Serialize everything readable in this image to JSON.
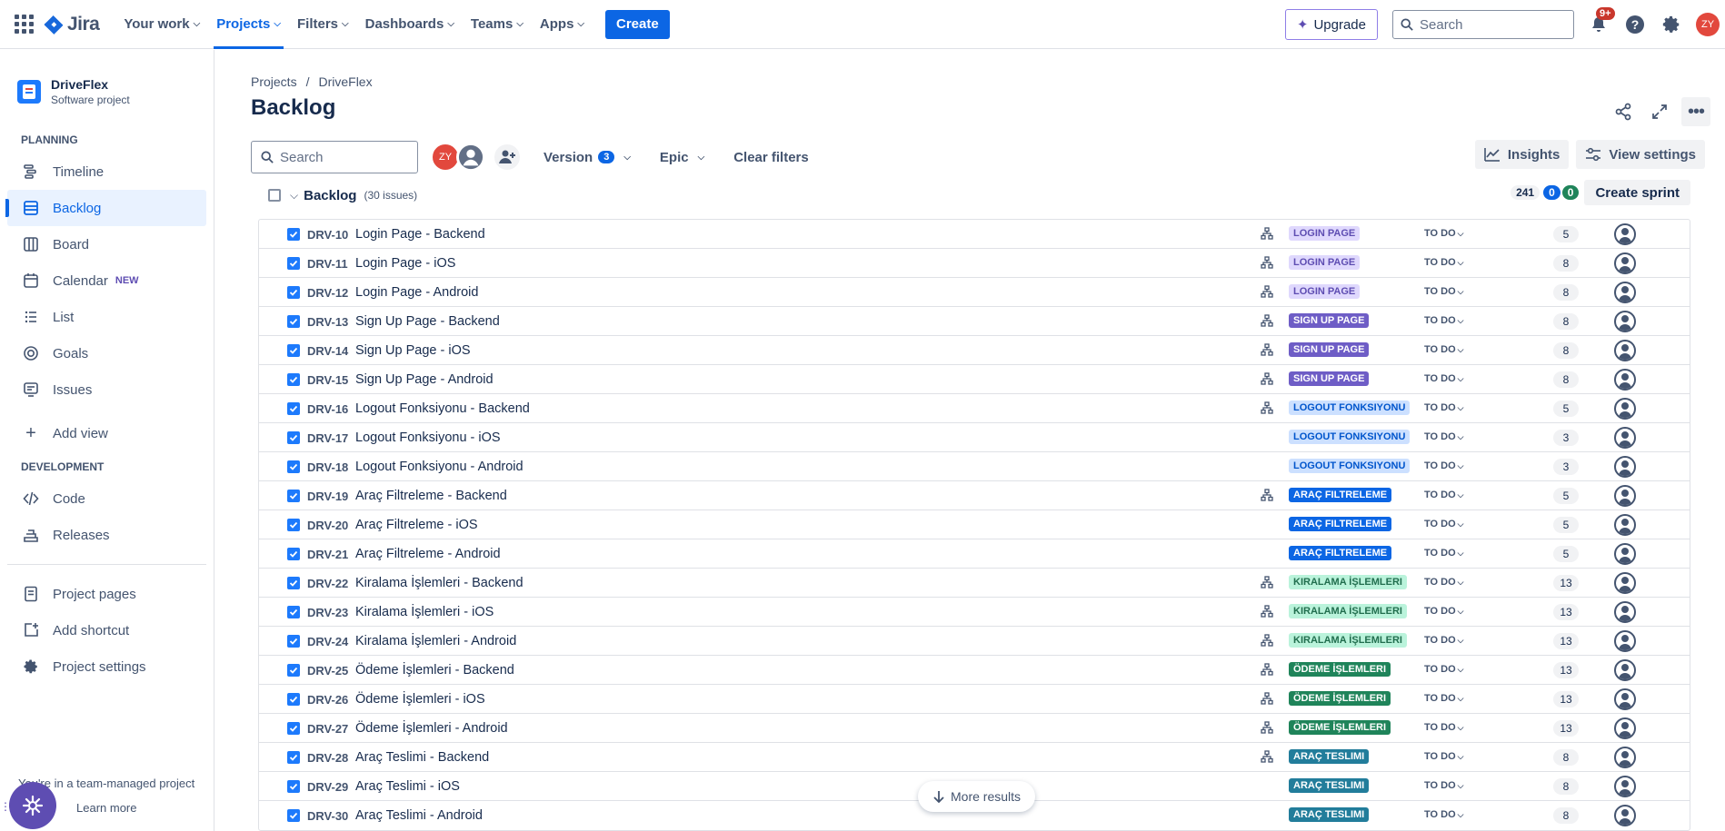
{
  "topbar": {
    "logo": "Jira",
    "nav": [
      {
        "label": "Your work",
        "active": false
      },
      {
        "label": "Projects",
        "active": true
      },
      {
        "label": "Filters",
        "active": false
      },
      {
        "label": "Dashboards",
        "active": false
      },
      {
        "label": "Teams",
        "active": false
      },
      {
        "label": "Apps",
        "active": false
      }
    ],
    "create_label": "Create",
    "upgrade_label": "Upgrade",
    "search_placeholder": "Search",
    "notifications_badge": "9+",
    "user_initials": "ZY"
  },
  "sidebar": {
    "project_name": "DriveFlex",
    "project_type": "Software project",
    "planning_title": "PLANNING",
    "planning_items": [
      {
        "label": "Timeline",
        "icon": "timeline-icon"
      },
      {
        "label": "Backlog",
        "icon": "backlog-icon",
        "active": true
      },
      {
        "label": "Board",
        "icon": "board-icon"
      },
      {
        "label": "Calendar",
        "icon": "calendar-icon",
        "tag": "NEW"
      },
      {
        "label": "List",
        "icon": "list-icon"
      },
      {
        "label": "Goals",
        "icon": "goals-icon"
      },
      {
        "label": "Issues",
        "icon": "issues-icon"
      }
    ],
    "add_view_label": "Add view",
    "development_title": "DEVELOPMENT",
    "development_items": [
      {
        "label": "Code",
        "icon": "code-icon"
      },
      {
        "label": "Releases",
        "icon": "releases-icon"
      }
    ],
    "project_pages_label": "Project pages",
    "add_shortcut_label": "Add shortcut",
    "project_settings_label": "Project settings",
    "footer_text": "You're in a team-managed project",
    "learn_more_label": "Learn more"
  },
  "main": {
    "breadcrumb": [
      "Projects",
      "DriveFlex"
    ],
    "title": "Backlog",
    "search_placeholder": "Search",
    "filter_avatar_initials": "ZY",
    "version_label": "Version",
    "version_count": "3",
    "epic_label": "Epic",
    "clear_filters_label": "Clear filters",
    "insights_label": "Insights",
    "view_settings_label": "View settings",
    "backlog_title": "Backlog",
    "backlog_count": "(30 issues)",
    "points_total": "241",
    "points_in_progress": "0",
    "points_done": "0",
    "create_sprint_label": "Create sprint",
    "more_results_label": "More results"
  },
  "colors": {
    "accent": "#0c66e4",
    "epic_login_bg": "#dfd8fd",
    "epic_login_fg": "#5e4db2",
    "epic_signup_bg": "#6e5dc6",
    "epic_signup_fg": "#ffffff",
    "epic_logout_bg": "#cce0ff",
    "epic_logout_fg": "#0055cc",
    "epic_filter_bg": "#0c66e4",
    "epic_filter_fg": "#ffffff",
    "epic_rental_bg": "#baf3db",
    "epic_rental_fg": "#216e4e",
    "epic_payment_bg": "#1f845a",
    "epic_payment_fg": "#ffffff",
    "epic_delivery_bg": "#227d9b",
    "epic_delivery_fg": "#ffffff"
  },
  "issues": [
    {
      "key": "DRV-10",
      "summary": "Login Page - Backend",
      "child": true,
      "epic": "LOGIN PAGE",
      "epic_style": "login",
      "status": "TO DO",
      "estimate": "5"
    },
    {
      "key": "DRV-11",
      "summary": "Login Page - iOS",
      "child": true,
      "epic": "LOGIN PAGE",
      "epic_style": "login",
      "status": "TO DO",
      "estimate": "8"
    },
    {
      "key": "DRV-12",
      "summary": "Login Page - Android",
      "child": true,
      "epic": "LOGIN PAGE",
      "epic_style": "login",
      "status": "TO DO",
      "estimate": "8"
    },
    {
      "key": "DRV-13",
      "summary": "Sign Up Page - Backend",
      "child": true,
      "epic": "SIGN UP PAGE",
      "epic_style": "signup",
      "status": "TO DO",
      "estimate": "8"
    },
    {
      "key": "DRV-14",
      "summary": "Sign Up Page - iOS",
      "child": true,
      "epic": "SIGN UP PAGE",
      "epic_style": "signup",
      "status": "TO DO",
      "estimate": "8"
    },
    {
      "key": "DRV-15",
      "summary": "Sign Up Page - Android",
      "child": true,
      "epic": "SIGN UP PAGE",
      "epic_style": "signup",
      "status": "TO DO",
      "estimate": "8"
    },
    {
      "key": "DRV-16",
      "summary": "Logout Fonksiyonu - Backend",
      "child": true,
      "epic": "LOGOUT FONKSIYONU",
      "epic_style": "logout",
      "status": "TO DO",
      "estimate": "5"
    },
    {
      "key": "DRV-17",
      "summary": "Logout Fonksiyonu - iOS",
      "child": false,
      "epic": "LOGOUT FONKSIYONU",
      "epic_style": "logout",
      "status": "TO DO",
      "estimate": "3"
    },
    {
      "key": "DRV-18",
      "summary": "Logout Fonksiyonu - Android",
      "child": false,
      "epic": "LOGOUT FONKSIYONU",
      "epic_style": "logout",
      "status": "TO DO",
      "estimate": "3"
    },
    {
      "key": "DRV-19",
      "summary": "Araç Filtreleme - Backend",
      "child": true,
      "epic": "ARAÇ FILTRELEME",
      "epic_style": "filter",
      "status": "TO DO",
      "estimate": "5"
    },
    {
      "key": "DRV-20",
      "summary": "Araç Filtreleme - iOS",
      "child": false,
      "epic": "ARAÇ FILTRELEME",
      "epic_style": "filter",
      "status": "TO DO",
      "estimate": "5"
    },
    {
      "key": "DRV-21",
      "summary": "Araç Filtreleme - Android",
      "child": false,
      "epic": "ARAÇ FILTRELEME",
      "epic_style": "filter",
      "status": "TO DO",
      "estimate": "5"
    },
    {
      "key": "DRV-22",
      "summary": "Kiralama İşlemleri - Backend",
      "child": true,
      "epic": "KIRALAMA İŞLEMLERI",
      "epic_style": "rental",
      "status": "TO DO",
      "estimate": "13"
    },
    {
      "key": "DRV-23",
      "summary": "Kiralama İşlemleri - iOS",
      "child": true,
      "epic": "KIRALAMA İŞLEMLERI",
      "epic_style": "rental",
      "status": "TO DO",
      "estimate": "13"
    },
    {
      "key": "DRV-24",
      "summary": "Kiralama İşlemleri - Android",
      "child": true,
      "epic": "KIRALAMA İŞLEMLERI",
      "epic_style": "rental",
      "status": "TO DO",
      "estimate": "13"
    },
    {
      "key": "DRV-25",
      "summary": "Ödeme İşlemleri - Backend",
      "child": true,
      "epic": "ÖDEME İŞLEMLERI",
      "epic_style": "payment",
      "status": "TO DO",
      "estimate": "13"
    },
    {
      "key": "DRV-26",
      "summary": "Ödeme İşlemleri - iOS",
      "child": true,
      "epic": "ÖDEME İŞLEMLERI",
      "epic_style": "payment",
      "status": "TO DO",
      "estimate": "13"
    },
    {
      "key": "DRV-27",
      "summary": "Ödeme İşlemleri - Android",
      "child": true,
      "epic": "ÖDEME İŞLEMLERI",
      "epic_style": "payment",
      "status": "TO DO",
      "estimate": "13"
    },
    {
      "key": "DRV-28",
      "summary": "Araç Teslimi - Backend",
      "child": true,
      "epic": "ARAÇ TESLIMI",
      "epic_style": "delivery",
      "status": "TO DO",
      "estimate": "8"
    },
    {
      "key": "DRV-29",
      "summary": "Araç Teslimi - iOS",
      "child": false,
      "epic": "ARAÇ TESLIMI",
      "epic_style": "delivery",
      "status": "TO DO",
      "estimate": "8"
    },
    {
      "key": "DRV-30",
      "summary": "Araç Teslimi - Android",
      "child": false,
      "epic": "ARAÇ TESLIMI",
      "epic_style": "delivery",
      "status": "TO DO",
      "estimate": "8"
    }
  ]
}
